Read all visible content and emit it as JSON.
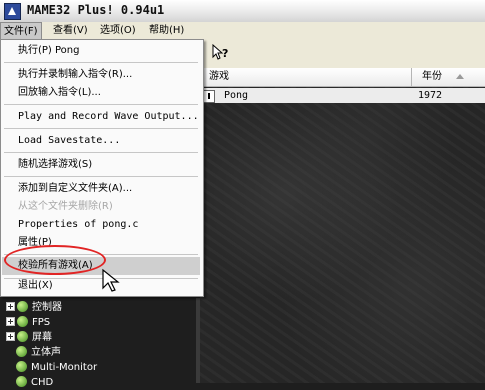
{
  "window": {
    "title": "MAME32 Plus! 0.94u1"
  },
  "menubar": [
    {
      "label": "文件(F)"
    },
    {
      "label": "查看(V)"
    },
    {
      "label": "选项(O)"
    },
    {
      "label": "帮助(H)"
    }
  ],
  "file_menu": {
    "items": [
      {
        "label": "执行(P) Pong"
      },
      {
        "label": "执行并录制输入指令(R)..."
      },
      {
        "label": "回放输入指令(L)..."
      },
      {
        "label": "Play and Record Wave Output..."
      },
      {
        "label": "Load Savestate..."
      },
      {
        "label": "随机选择游戏(S)"
      },
      {
        "label": "添加到自定义文件夹(A)..."
      },
      {
        "label": "从这个文件夹删除(R)"
      },
      {
        "label": "Properties of pong.c"
      },
      {
        "label": "属性(P)"
      },
      {
        "label": "校验所有游戏(A)"
      },
      {
        "label": "退出(X)"
      }
    ]
  },
  "game_list": {
    "columns": [
      {
        "label": "游戏"
      },
      {
        "label": "年份"
      }
    ],
    "rows": [
      {
        "game": "Pong",
        "year": "1972"
      }
    ]
  },
  "folder_tree": {
    "items": [
      {
        "label": "控制器"
      },
      {
        "label": "FPS"
      },
      {
        "label": "屏幕"
      },
      {
        "label": "立体声"
      },
      {
        "label": "Multi-Monitor"
      },
      {
        "label": "CHD"
      }
    ]
  },
  "colors": {
    "annotation_circle": "#e12424",
    "highlight": "#cfcfcf"
  },
  "icons": {
    "toolbar_help": "help-pointer-icon",
    "app": "mame-icon"
  }
}
